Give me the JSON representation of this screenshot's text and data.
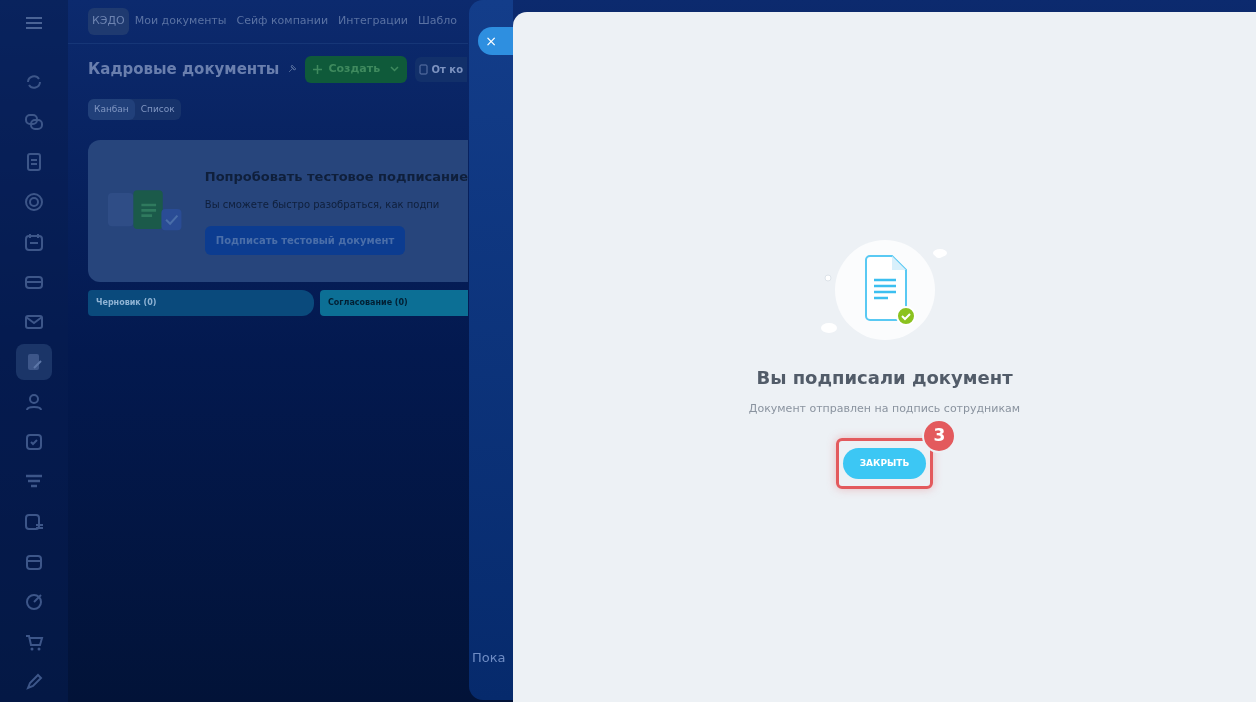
{
  "sidebar": {
    "items": [
      {
        "selected": false
      },
      {
        "selected": false
      },
      {
        "selected": false
      },
      {
        "selected": false
      },
      {
        "selected": false
      },
      {
        "selected": false
      },
      {
        "selected": false
      },
      {
        "selected": true
      },
      {
        "selected": false
      },
      {
        "selected": false
      },
      {
        "selected": false
      },
      {
        "selected": false
      },
      {
        "selected": false
      },
      {
        "selected": false
      },
      {
        "selected": false
      },
      {
        "selected": false
      }
    ]
  },
  "top_nav": [
    {
      "label": "КЭДО",
      "selected": true
    },
    {
      "label": "Мои документы",
      "selected": false
    },
    {
      "label": "Сейф компании",
      "selected": false
    },
    {
      "label": "Интеграции",
      "selected": false
    },
    {
      "label": "Шабло",
      "selected": false
    }
  ],
  "page": {
    "title": "Кадровые документы",
    "create_button": "Создать",
    "from_button": "От ко"
  },
  "view_switch": [
    {
      "label": "Канбан",
      "selected": true
    },
    {
      "label": "Список",
      "selected": false
    }
  ],
  "promo": {
    "title": "Попробовать тестовое подписание",
    "text": "Вы сможете быстро разобраться, как подпи",
    "button": "Подписать тестовый документ"
  },
  "kanban_columns": [
    {
      "title": "Черновик",
      "count": "(0)"
    },
    {
      "title": "Согласование",
      "count": "(0)"
    }
  ],
  "empty_text": "Пока",
  "dialog": {
    "close_icon": "×",
    "title": "Вы подписали документ",
    "subtitle": "Документ отправлен на подпись сотрудникам",
    "button": "ЗАКРЫТЬ",
    "step_badge": "3"
  }
}
